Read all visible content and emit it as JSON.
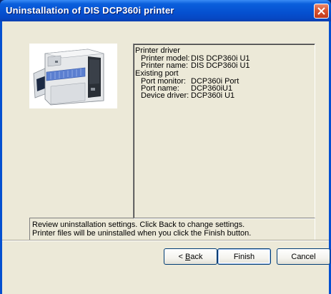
{
  "window": {
    "title": "Uninstallation of DIS DCP360i printer"
  },
  "settings": [
    {
      "indent": false,
      "label": "Printer driver",
      "value": ""
    },
    {
      "indent": true,
      "label": "Printer model:",
      "value": "DIS DCP360i U1"
    },
    {
      "indent": true,
      "label": "Printer name:",
      "value": "DIS DCP360i U1"
    },
    {
      "indent": false,
      "label": "Existing port",
      "value": ""
    },
    {
      "indent": true,
      "label": "Port monitor:",
      "value": "DCP360i Port"
    },
    {
      "indent": true,
      "label": "Port name:",
      "value": "DCP360iU1"
    },
    {
      "indent": true,
      "label": "Device driver:",
      "value": "DCP360i U1"
    }
  ],
  "summary": {
    "line1": "Review uninstallation settings. Click Back to change settings.",
    "line2": "Printer files will be uninstalled when you click the Finish button."
  },
  "buttons": {
    "back_prefix": "< ",
    "back_mnemonic": "B",
    "back_rest": "ack",
    "finish": "Finish",
    "cancel": "Cancel"
  },
  "icons": {
    "close": "close-icon",
    "printer": "printer-icon"
  },
  "colors": {
    "title_bar": "#0550d0",
    "dialog_bg": "#ece9d8",
    "close_button": "#d8532f"
  }
}
